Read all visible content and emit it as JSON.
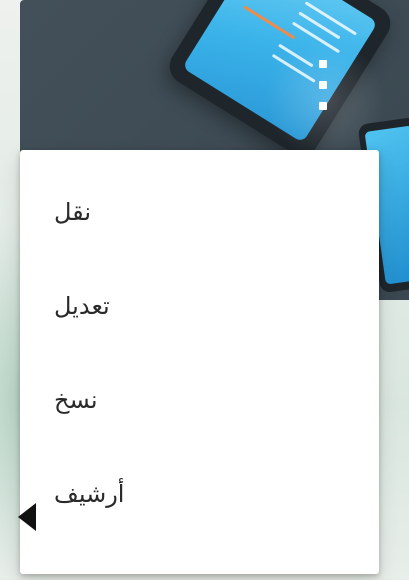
{
  "menu": {
    "items": [
      {
        "label": "نقل"
      },
      {
        "label": "تعديل"
      },
      {
        "label": "نسخ"
      },
      {
        "label": "أرشيف"
      }
    ]
  },
  "banner": {
    "kebab_icon": "more-vert-icon",
    "illustration": "phone-illustration"
  },
  "pointer": {
    "icon": "arrow-pointer-icon"
  }
}
